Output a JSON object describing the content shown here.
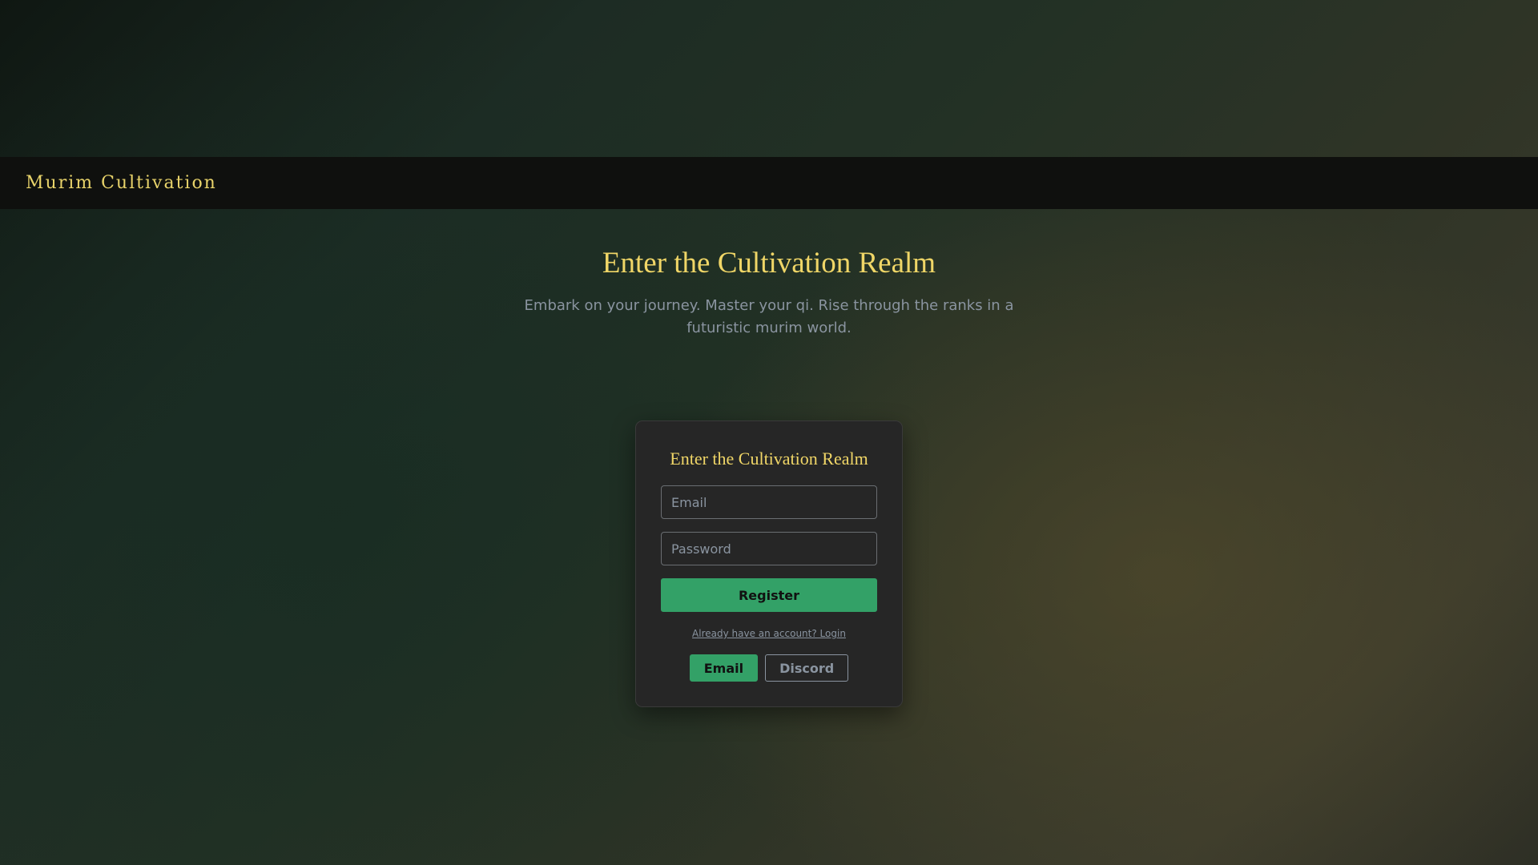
{
  "navbar": {
    "brand": "Murim Cultivation"
  },
  "hero": {
    "title": "Enter the Cultivation Realm",
    "subtitle": "Embark on your journey. Master your qi. Rise through the ranks in a futuristic murim world."
  },
  "auth_card": {
    "title": "Enter the Cultivation Realm",
    "email_placeholder": "Email",
    "password_placeholder": "Password",
    "submit_label": "Register",
    "switch_link": "Already have an account? Login",
    "methods": [
      {
        "label": "Email",
        "active": true
      },
      {
        "label": "Discord",
        "active": false
      }
    ]
  },
  "colors": {
    "accent_gold": "#f0d667",
    "accent_green": "#33a167",
    "muted_text": "#8a94a0",
    "card_bg": "#262626",
    "navbar_bg": "#0f100e"
  }
}
